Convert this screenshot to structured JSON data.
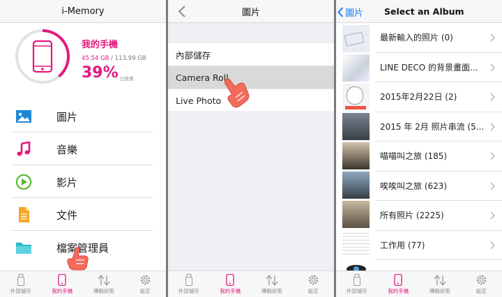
{
  "panel1": {
    "title": "i-Memory",
    "device": {
      "name": "我的手機",
      "used": "45.54 GB",
      "separator": " / ",
      "total": "113.99 GB",
      "percent": "39%",
      "percent_label": "已使用",
      "percent_value": 0.39
    },
    "menu": [
      {
        "label": "圖片",
        "icon": "picture-icon",
        "color": "#1e88d6"
      },
      {
        "label": "音樂",
        "icon": "music-note-icon",
        "color": "#e3197f"
      },
      {
        "label": "影片",
        "icon": "play-icon",
        "color": "#5ab82f"
      },
      {
        "label": "文件",
        "icon": "document-icon",
        "color": "#f5a623"
      },
      {
        "label": "檔案管理員",
        "icon": "folder-icon",
        "color": "#2bb7c9"
      }
    ]
  },
  "panel2": {
    "title": "圖片",
    "rows": [
      "內部儲存",
      "Camera Roll",
      "Live Photo"
    ]
  },
  "panel3": {
    "back_label": "圖片",
    "title": "Select an Album",
    "albums": [
      "最新輸入的照片 (0)",
      "LINE DECO 的背景畫面...",
      "2015年2月22日 (2)",
      "2015 年 2月 照片串流 (5...",
      "喵喵叫之旅 (185)",
      "唉唉叫之旅 (623)",
      "所有照片 (2225)",
      "工作用 (77)"
    ]
  },
  "tabs": [
    {
      "label": "外部儲存",
      "icon": "usb-drive-icon"
    },
    {
      "label": "我的手機",
      "icon": "phone-icon"
    },
    {
      "label": "傳輸狀態",
      "icon": "transfer-arrows-icon"
    },
    {
      "label": "設定",
      "icon": "gear-icon"
    }
  ],
  "colors": {
    "accent": "#e3197f",
    "link": "#1e7cf2",
    "hand": "#f26b5b"
  }
}
